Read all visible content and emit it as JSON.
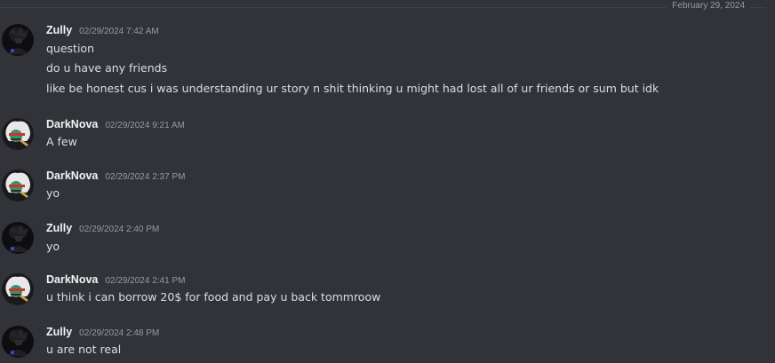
{
  "date_divider": "February 29, 2024",
  "messages": [
    {
      "author": "Zully",
      "timestamp": "02/29/2024 7:42 AM",
      "lines": [
        "question",
        "do u have any friends",
        "like be honest cus i was understanding ur story n shit thinking u might had lost all of ur friends or sum but idk"
      ]
    },
    {
      "author": "DarkNova",
      "timestamp": "02/29/2024 9:21 AM",
      "lines": [
        "A few"
      ]
    },
    {
      "author": "DarkNova",
      "timestamp": "02/29/2024 2:37 PM",
      "lines": [
        "yo"
      ]
    },
    {
      "author": "Zully",
      "timestamp": "02/29/2024 2:40 PM",
      "lines": [
        "yo"
      ]
    },
    {
      "author": "DarkNova",
      "timestamp": "02/29/2024 2:41 PM",
      "lines": [
        "u think i can borrow 20$ for food and pay u back tommroow"
      ]
    },
    {
      "author": "Zully",
      "timestamp": "02/29/2024 2:48 PM",
      "lines": [
        "u are not real"
      ]
    }
  ],
  "icons": {
    "zully_avatar": "avatar-zully-icon",
    "darknova_avatar": "avatar-darknova-icon"
  },
  "colors": {
    "background": "#313338",
    "username": "#f2f3f5",
    "message_text": "#dbdee1",
    "timestamp": "#949ba4"
  }
}
